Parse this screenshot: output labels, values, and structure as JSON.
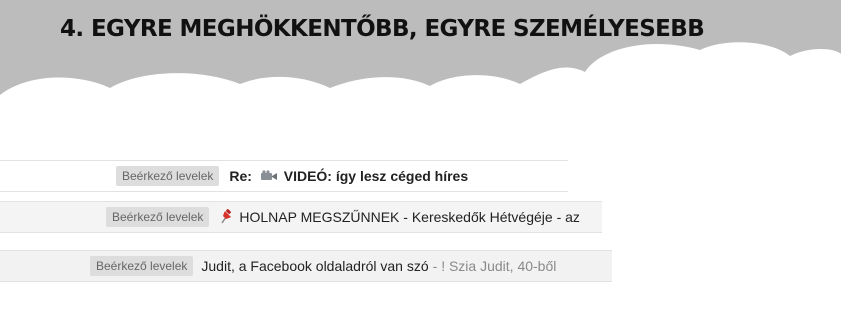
{
  "slide": {
    "title": "4. EGYRE MEGHÖKKENTŐBB, EGYRE SZEMÉLYESEBB"
  },
  "emails": [
    {
      "label": "Beérkező levelek",
      "subject_prefix": "Re:",
      "subject": "VIDEÓ: így lesz céged híres",
      "icon": "film-camera-icon"
    },
    {
      "label": "Beérkező levelek",
      "subject": "HOLNAP MEGSZŰNNEK - Kereskedők Hétvégéje - az",
      "icon": "pushpin-icon"
    },
    {
      "label": "Beérkező levelek",
      "subject": "Judit, a Facebook oldaladról van szó",
      "snippet": "- ! Szia Judit, 40-ből"
    }
  ],
  "colors": {
    "banner_gray": "#bcbcbc",
    "cloud_white": "#ffffff",
    "label_chip_bg": "#dddddd",
    "pin_red": "#d7322a"
  }
}
